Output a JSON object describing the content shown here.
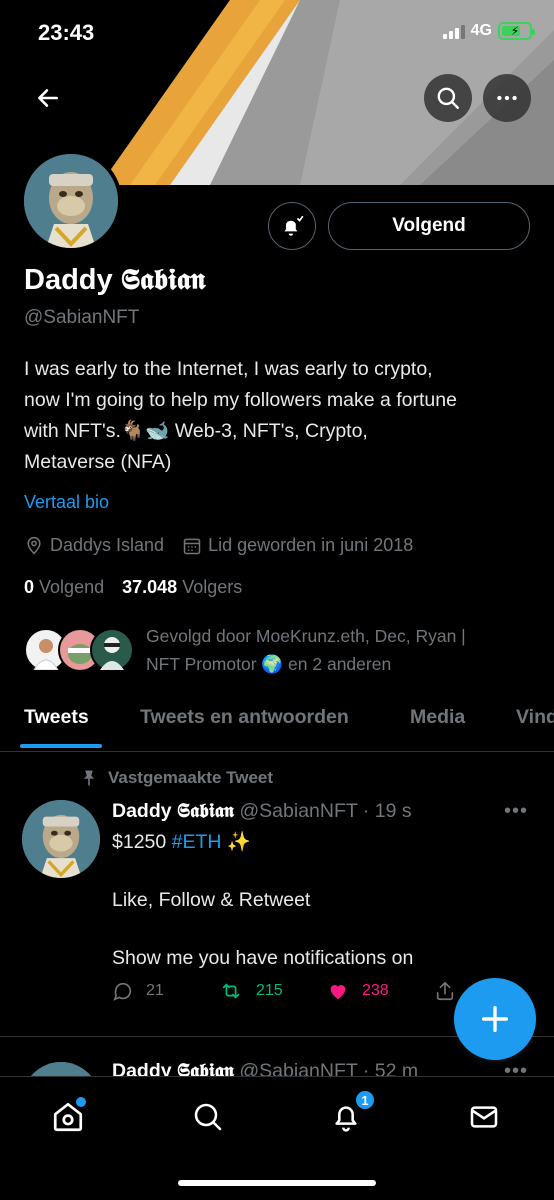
{
  "status_bar": {
    "time": "23:43",
    "network": "4G"
  },
  "profile": {
    "display_name": "Daddy 𝕾𝖆𝖇𝖎𝖆𝖓",
    "handle": "@SabianNFT",
    "bio_line1": "I was early to the Internet, I was early to crypto,",
    "bio_line2": "now I'm going to help my followers make a fortune",
    "bio_line3": "with NFT's.🐐🐋 Web-3, NFT's, Crypto,",
    "bio_line4": "Metaverse (NFA)",
    "translate_label": "Vertaal bio",
    "location": "Daddys Island",
    "joined": "Lid geworden in juni 2018",
    "following_count": "0",
    "following_label": "Volgend",
    "followers_count": "37.048",
    "followers_label": "Volgers",
    "follow_button_label": "Volgend",
    "followed_by_line1": "Gevolgd door MoeKrunz.eth, Dec, Ryan |",
    "followed_by_line2": "NFT Promotor 🌍 en 2 anderen"
  },
  "tabs": [
    {
      "label": "Tweets"
    },
    {
      "label": "Tweets en antwoorden"
    },
    {
      "label": "Media"
    },
    {
      "label": "Vind-ik-leuks"
    }
  ],
  "pinned_tweet": {
    "pinned_label": "Vastgemaakte Tweet",
    "author_name": "Daddy 𝕾𝖆𝖇𝖎𝖆𝖓",
    "author_handle_time": "@SabianNFT · 19 s",
    "text_prefix": "$1250 ",
    "hashtag": "#ETH",
    "text_suffix": " ✨",
    "line2": "Like, Follow & Retweet",
    "line3": "Show me you have notifications on",
    "replies": "21",
    "retweets": "215",
    "likes": "238"
  },
  "second_tweet": {
    "author_name": "Daddy 𝕾𝖆𝖇𝖎𝖆𝖓",
    "author_handle_time": "@SabianNFT · 52 m"
  },
  "bottom_nav": {
    "notification_count": "1"
  },
  "colors": {
    "accent": "#1d9bf0",
    "retweet": "#00ba7c",
    "like": "#f91880",
    "muted": "#71767b"
  }
}
